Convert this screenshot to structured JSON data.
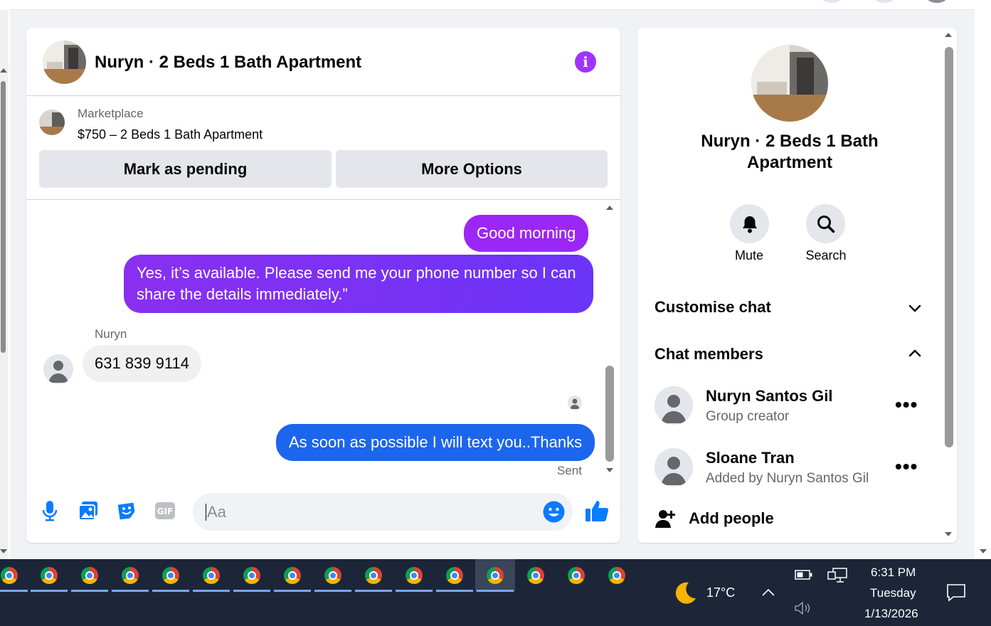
{
  "chat": {
    "title": "Nuryn · 2 Beds 1 Bath Apartment",
    "marketplace_label": "Marketplace",
    "listing": "$750 – 2 Beds 1 Bath Apartment",
    "mark_pending": "Mark as pending",
    "more_options": "More Options",
    "messages": {
      "m1": "Good morning",
      "m2": "Yes, it’s available. Please send me your phone number so I can share the details immediately.”",
      "sender": "Nuryn",
      "m3": "631 839 9114",
      "m4": "As soon as possible I will text you..Thanks",
      "status": "Sent"
    },
    "input_placeholder": "Aa"
  },
  "info": {
    "title": "Nuryn · 2 Beds 1 Bath Apartment",
    "mute": "Mute",
    "search": "Search",
    "customise": "Customise chat",
    "members_heading": "Chat members",
    "members": [
      {
        "name": "Nuryn Santos Gil",
        "sub": "Group creator"
      },
      {
        "name": "Sloane Tran",
        "sub": "Added by Nuryn Santos Gil"
      }
    ],
    "add_people": "Add people"
  },
  "taskbar": {
    "weather": "17°C",
    "time": "6:31 PM",
    "day": "Tuesday",
    "date": "1/13/2026"
  },
  "colors": {
    "purple": "#a033ff",
    "blue": "#0a7cff",
    "bubble_blue": "#1b66ec"
  }
}
